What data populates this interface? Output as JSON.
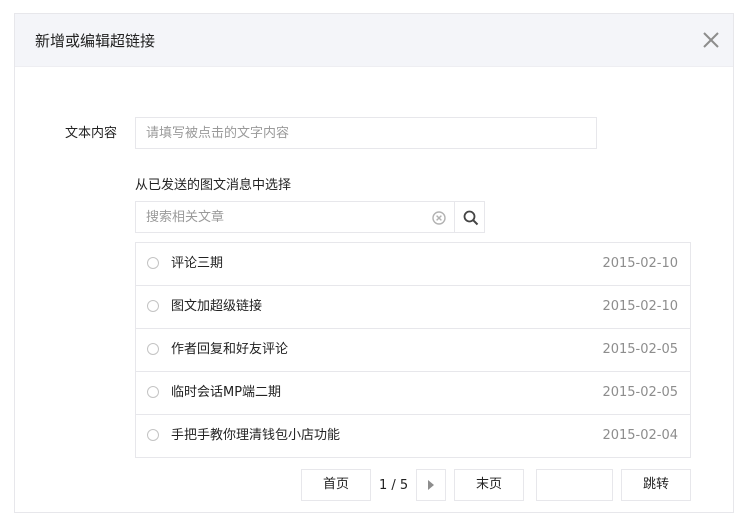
{
  "dialog": {
    "title": "新增或编辑超链接",
    "close_icon": "close-icon"
  },
  "form": {
    "text_label": "文本内容",
    "text_placeholder": "请填写被点击的文字内容",
    "text_value": "",
    "section_label": "从已发送的图文消息中选择",
    "search_placeholder": "搜索相关文章",
    "search_value": "",
    "search_icon": "search-icon",
    "clear_icon": "clear-icon"
  },
  "articles": [
    {
      "title": "评论三期",
      "date": "2015-02-10"
    },
    {
      "title": "图文加超级链接",
      "date": "2015-02-10"
    },
    {
      "title": "作者回复和好友评论",
      "date": "2015-02-05"
    },
    {
      "title": "临时会话MP端二期",
      "date": "2015-02-05"
    },
    {
      "title": "手把手教你理清钱包小店功能",
      "date": "2015-02-04"
    }
  ],
  "pager": {
    "first_label": "首页",
    "page_info": "1 / 5",
    "next_icon": "triangle-right-icon",
    "last_label": "末页",
    "page_input_value": "",
    "jump_label": "跳转"
  }
}
